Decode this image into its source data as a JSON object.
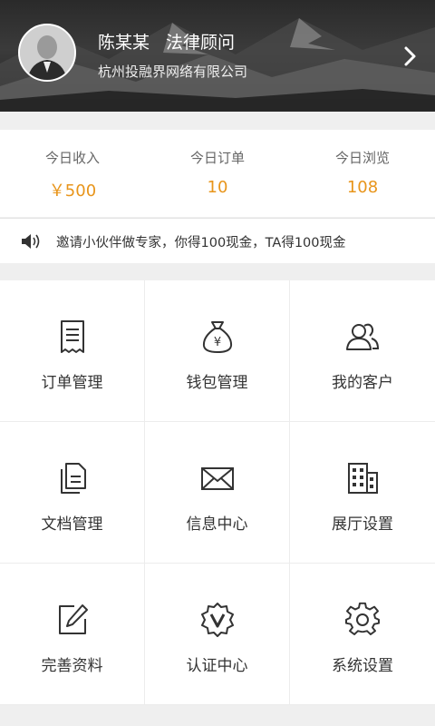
{
  "profile": {
    "name": "陈某某",
    "title": "法律顾问",
    "company": "杭州投融界网络有限公司"
  },
  "stats": [
    {
      "label": "今日收入",
      "value": "￥500"
    },
    {
      "label": "今日订单",
      "value": "10"
    },
    {
      "label": "今日浏览",
      "value": "108"
    }
  ],
  "notice": {
    "text": "邀请小伙伴做专家，你得100现金，TA得100现金",
    "icon": "speaker-icon"
  },
  "menu": [
    {
      "label": "订单管理",
      "icon": "receipt-icon"
    },
    {
      "label": "钱包管理",
      "icon": "money-bag-icon"
    },
    {
      "label": "我的客户",
      "icon": "customers-icon"
    },
    {
      "label": "文档管理",
      "icon": "documents-icon"
    },
    {
      "label": "信息中心",
      "icon": "envelope-icon"
    },
    {
      "label": "展厅设置",
      "icon": "building-icon"
    },
    {
      "label": "完善资料",
      "icon": "edit-icon"
    },
    {
      "label": "认证中心",
      "icon": "verified-icon"
    },
    {
      "label": "系统设置",
      "icon": "gear-icon"
    }
  ],
  "colors": {
    "accent": "#e8951b",
    "icon_stroke": "#333333",
    "header_bg": "#2a2a2a"
  }
}
